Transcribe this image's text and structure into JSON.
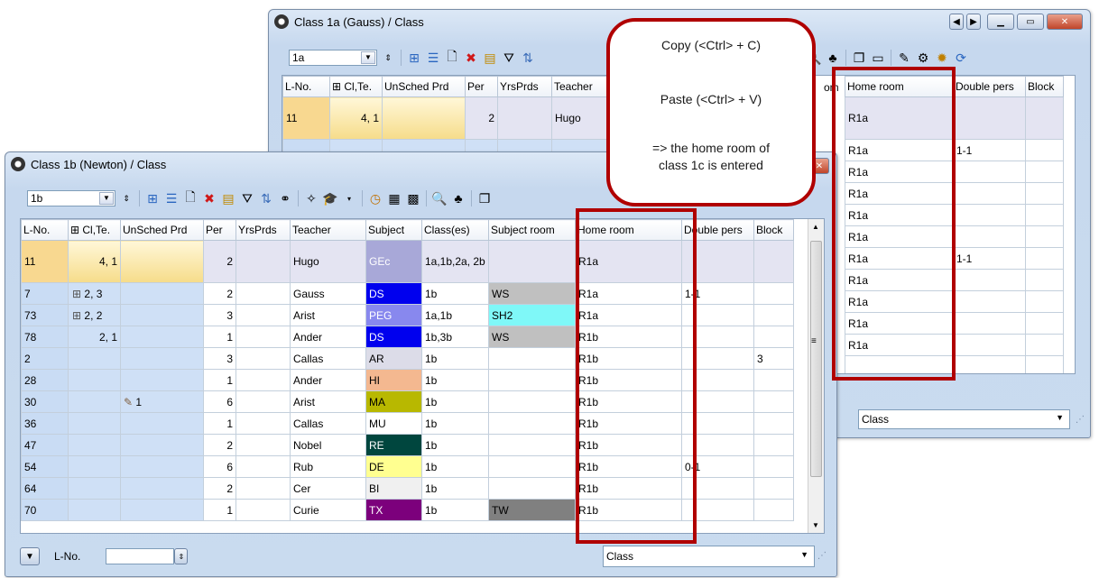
{
  "back_window": {
    "title": "Class 1a (Gauss) / Class",
    "class_selector": "1a",
    "columns": [
      "L-No.",
      "Cl,Te.",
      "UnSched Prd",
      "Per",
      "YrsPrds",
      "Teacher",
      "Home room",
      "Double pers",
      "Block"
    ],
    "first_row": {
      "lno": "11",
      "clte": "4, 1",
      "per": "2",
      "teacher": "Hugo",
      "home": "R1a"
    },
    "home_room_values": [
      "R1a",
      "R1a",
      "R1a",
      "R1a",
      "R1a",
      "R1a",
      "R1a",
      "R1a",
      "R1a",
      "R1a"
    ],
    "double_pers_values": [
      "1-1",
      "",
      "",
      "",
      "",
      "1-1",
      "",
      "",
      "",
      ""
    ],
    "status_combo": "Class",
    "hidden_column_fragment": "om"
  },
  "front_window": {
    "title": "Class 1b (Newton) / Class",
    "class_selector": "1b",
    "columns": [
      "L-No.",
      "Cl,Te.",
      "UnSched Prd",
      "Per",
      "YrsPrds",
      "Teacher",
      "Subject",
      "Class(es)",
      "Subject room",
      "Home room",
      "Double pers",
      "Block"
    ],
    "rows": [
      {
        "lno": "11",
        "clte": "4, 1",
        "unsched": "",
        "per": "2",
        "teacher": "Hugo",
        "subject": "GEc",
        "subj_bg": "#a8a8d8",
        "subj_fg": "#ffffff",
        "classes": "1a,1b,2a, 2b",
        "sroom": "",
        "sroom_bg": "",
        "home": "R1a",
        "double": "",
        "block": "",
        "hl": true
      },
      {
        "lno": "7",
        "clte": "2, 3",
        "expand": true,
        "unsched": "",
        "per": "2",
        "teacher": "Gauss",
        "subject": "DS",
        "subj_bg": "#0000ee",
        "subj_fg": "#ffffff",
        "classes": "1b",
        "sroom": "WS",
        "sroom_bg": "#c0c0c0",
        "home": "R1a",
        "double": "1-1",
        "block": ""
      },
      {
        "lno": "73",
        "clte": "2, 2",
        "expand": true,
        "unsched": "",
        "per": "3",
        "teacher": "Arist",
        "subject": "PEG",
        "subj_bg": "#8888ee",
        "subj_fg": "#ffffff",
        "classes": "1a,1b",
        "sroom": "SH2",
        "sroom_bg": "#7ff8f8",
        "home": "R1a",
        "double": "",
        "block": ""
      },
      {
        "lno": "78",
        "clte": "2, 1",
        "unsched": "",
        "per": "1",
        "teacher": "Ander",
        "subject": "DS",
        "subj_bg": "#0000ee",
        "subj_fg": "#ffffff",
        "classes": "1b,3b",
        "sroom": "WS",
        "sroom_bg": "#c0c0c0",
        "home": "R1b",
        "double": "",
        "block": ""
      },
      {
        "lno": "2",
        "clte": "",
        "unsched": "",
        "per": "3",
        "teacher": "Callas",
        "subject": "AR",
        "subj_bg": "#dcdce8",
        "subj_fg": "#000000",
        "classes": "1b",
        "sroom": "",
        "sroom_bg": "",
        "home": "R1b",
        "double": "",
        "block": "3"
      },
      {
        "lno": "28",
        "clte": "",
        "unsched": "",
        "per": "1",
        "teacher": "Ander",
        "subject": "HI",
        "subj_bg": "#f4b890",
        "subj_fg": "#000000",
        "classes": "1b",
        "sroom": "",
        "sroom_bg": "",
        "home": "R1b",
        "double": "",
        "block": ""
      },
      {
        "lno": "30",
        "clte": "",
        "unsched": "1",
        "pin": true,
        "per": "6",
        "teacher": "Arist",
        "subject": "MA",
        "subj_bg": "#b8b800",
        "subj_fg": "#000000",
        "classes": "1b",
        "sroom": "",
        "sroom_bg": "",
        "home": "R1b",
        "double": "",
        "block": ""
      },
      {
        "lno": "36",
        "clte": "",
        "unsched": "",
        "per": "1",
        "teacher": "Callas",
        "subject": "MU",
        "subj_bg": "#ffffff",
        "subj_fg": "#000000",
        "classes": "1b",
        "sroom": "",
        "sroom_bg": "",
        "home": "R1b",
        "double": "",
        "block": ""
      },
      {
        "lno": "47",
        "clte": "",
        "unsched": "",
        "per": "2",
        "teacher": "Nobel",
        "subject": "RE",
        "subj_bg": "#00463e",
        "subj_fg": "#ffffff",
        "classes": "1b",
        "sroom": "",
        "sroom_bg": "",
        "home": "R1b",
        "double": "",
        "block": ""
      },
      {
        "lno": "54",
        "clte": "",
        "unsched": "",
        "per": "6",
        "teacher": "Rub",
        "subject": "DE",
        "subj_bg": "#ffff90",
        "subj_fg": "#000000",
        "classes": "1b",
        "sroom": "",
        "sroom_bg": "",
        "home": "R1b",
        "double": "0-1",
        "block": ""
      },
      {
        "lno": "64",
        "clte": "",
        "unsched": "",
        "per": "2",
        "teacher": "Cer",
        "subject": "BI",
        "subj_bg": "#f0f0f0",
        "subj_fg": "#000000",
        "classes": "1b",
        "sroom": "",
        "sroom_bg": "",
        "home": "R1b",
        "double": "",
        "block": ""
      },
      {
        "lno": "70",
        "clte": "",
        "unsched": "",
        "per": "1",
        "teacher": "Curie",
        "subject": "TX",
        "subj_bg": "#7c007c",
        "subj_fg": "#ffffff",
        "classes": "1b",
        "sroom": "TW",
        "sroom_bg": "#808080",
        "home": "R1b",
        "double": "",
        "block": ""
      }
    ],
    "status_label": "L-No.",
    "status_combo": "Class"
  },
  "callout": {
    "line1": "Copy (<Ctrl> + C)",
    "line2": "Paste (<Ctrl> + V)",
    "line3": "=> the home room of",
    "line4": "class 1c is entered"
  }
}
